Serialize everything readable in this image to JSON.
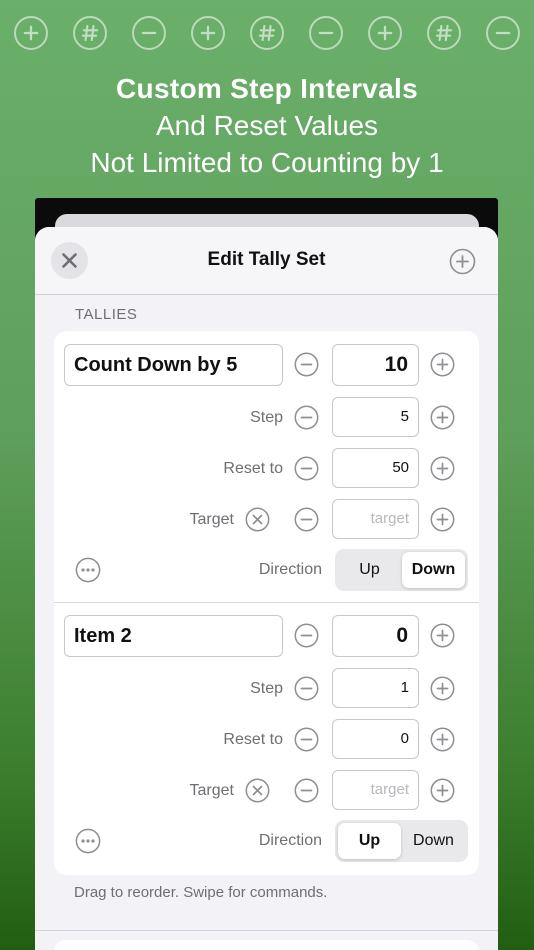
{
  "header_icons": [
    {
      "icon": "plus-circle-icon"
    },
    {
      "icon": "number-circle-icon"
    },
    {
      "icon": "minus-circle-icon"
    },
    {
      "icon": "plus-circle-icon"
    },
    {
      "icon": "number-circle-icon"
    },
    {
      "icon": "minus-circle-icon"
    },
    {
      "icon": "plus-circle-icon"
    },
    {
      "icon": "number-circle-icon"
    },
    {
      "icon": "minus-circle-icon"
    }
  ],
  "headline": {
    "line1": "Custom Step Intervals",
    "line2": "And Reset Values",
    "line3": "Not Limited to Counting by 1"
  },
  "sheet": {
    "title": "Edit Tally Set",
    "section_header": "TALLIES",
    "footer_note": "Drag to reorder. Swipe for commands."
  },
  "labels": {
    "step": "Step",
    "reset": "Reset to",
    "target": "Target",
    "direction": "Direction",
    "up": "Up",
    "down": "Down"
  },
  "tallies": [
    {
      "name": "Count Down by 5",
      "count": "10",
      "step": "5",
      "reset": "50",
      "target_placeholder": "target",
      "direction": "Down"
    },
    {
      "name": "Item 2",
      "count": "0",
      "step": "1",
      "reset": "0",
      "target_placeholder": "target",
      "direction": "Up"
    }
  ],
  "colors": {
    "background_top": "#6aaf6a",
    "background_bottom": "#225e12",
    "accent_icon": "#8e8e93"
  }
}
